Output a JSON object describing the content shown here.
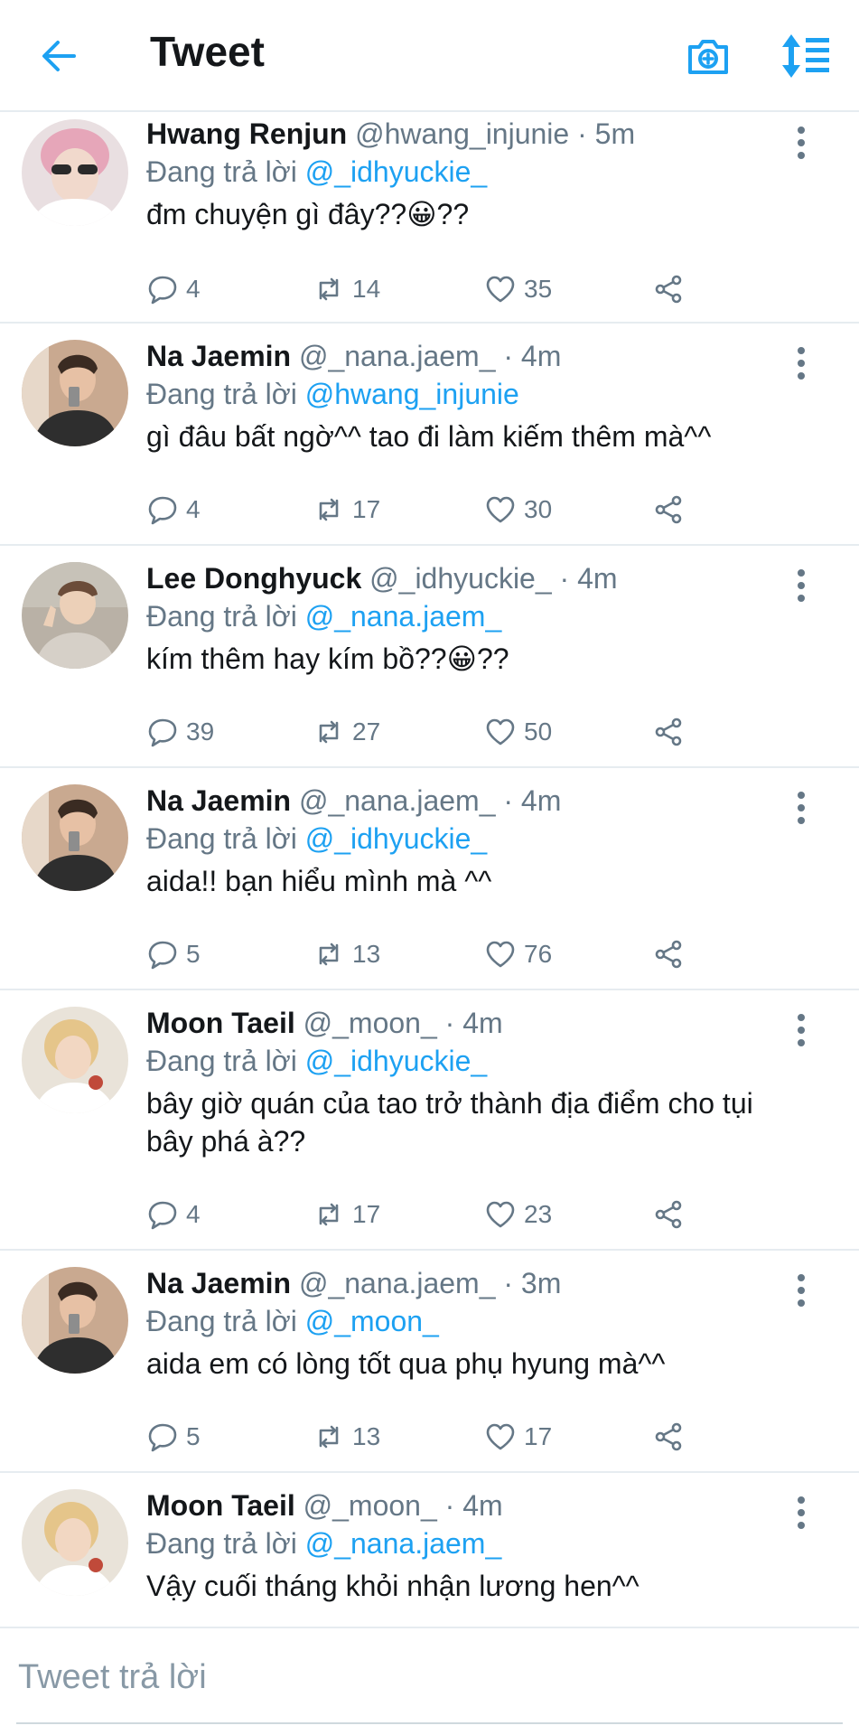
{
  "header": {
    "title": "Tweet",
    "back_icon": "arrow-left-icon",
    "camera_icon": "camera-add-icon",
    "sort_icon": "sort-icon",
    "accent": "#1da1f2"
  },
  "tweets": [
    {
      "name": "Hwang Renjun",
      "handle": "@hwang_injunie",
      "time": "· 5m",
      "reply_prefix": "Đang trả lời",
      "reply_to": "@_idhyuckie_",
      "text": "đm chuyện gì đây??😀??",
      "replies": "4",
      "retweets": "14",
      "likes": "35"
    },
    {
      "name": "Na Jaemin",
      "handle": "@_nana.jaem_",
      "time": "· 4m",
      "reply_prefix": "Đang trả lời",
      "reply_to": "@hwang_injunie",
      "text": "gì đâu bất ngờ^^ tao đi làm kiếm thêm mà^^",
      "replies": "4",
      "retweets": "17",
      "likes": "30"
    },
    {
      "name": "Lee Donghyuck",
      "handle": "@_idhyuckie_",
      "time": "· 4m",
      "reply_prefix": "Đang trả lời",
      "reply_to": "@_nana.jaem_",
      "text": "kím thêm hay kím bồ??😀??",
      "replies": "39",
      "retweets": "27",
      "likes": "50"
    },
    {
      "name": "Na Jaemin",
      "handle": "@_nana.jaem_",
      "time": "· 4m",
      "reply_prefix": "Đang trả lời",
      "reply_to": "@_idhyuckie_",
      "text": "aida!! bạn hiểu mình mà ^^",
      "replies": "5",
      "retweets": "13",
      "likes": "76"
    },
    {
      "name": "Moon Taeil",
      "handle": "@_moon_",
      "time": "· 4m",
      "reply_prefix": "Đang trả lời",
      "reply_to": "@_idhyuckie_",
      "text": "bây giờ quán của tao trở thành địa điểm cho tụi bây phá à??",
      "replies": "4",
      "retweets": "17",
      "likes": "23"
    },
    {
      "name": "Na Jaemin",
      "handle": "@_nana.jaem_",
      "time": "· 3m",
      "reply_prefix": "Đang trả lời",
      "reply_to": "@_moon_",
      "text": "aida em có lòng tốt qua phụ hyung mà^^",
      "replies": "5",
      "retweets": "13",
      "likes": "17"
    },
    {
      "name": "Moon Taeil",
      "handle": "@_moon_",
      "time": "· 4m",
      "reply_prefix": "Đang trả lời",
      "reply_to": "@_nana.jaem_",
      "text": "Vậy cuối tháng khỏi nhận lương hen^^"
    }
  ],
  "reply_box": {
    "placeholder": "Tweet trả lời"
  }
}
